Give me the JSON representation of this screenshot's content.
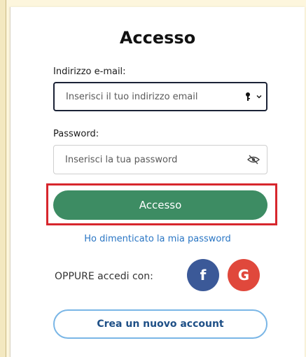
{
  "form": {
    "title": "Accesso",
    "email": {
      "label": "Indirizzo e-mail:",
      "placeholder": "Inserisci il tuo indirizzo email",
      "value": ""
    },
    "password": {
      "label": "Password:",
      "placeholder": "Inserisci la tua password",
      "value": ""
    },
    "submit_label": "Accesso",
    "forgot_link": "Ho dimenticato la mia password",
    "social_prompt": "OPPURE accedi con:",
    "social_facebook": "f",
    "social_google": "G",
    "create_account_label": "Crea un nuovo account"
  },
  "colors": {
    "primary_button": "#3d8c63",
    "link": "#2a76c4",
    "facebook": "#3b5998",
    "google": "#e0483c",
    "highlight": "#d7262d"
  },
  "icons": {
    "email_trailing": "key-dropdown-icon",
    "password_trailing": "eye-slash-icon"
  }
}
